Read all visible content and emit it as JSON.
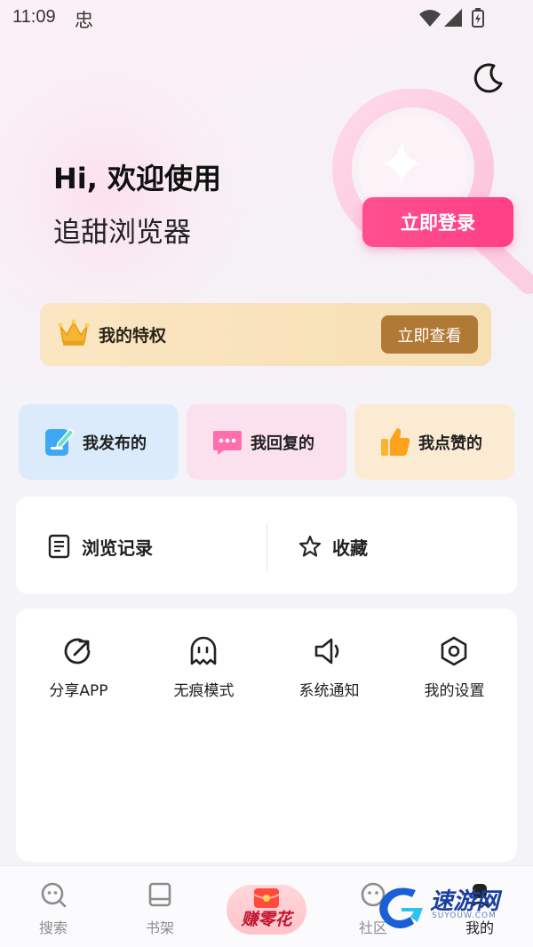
{
  "status_bar": {
    "time": "11:09",
    "extra_glyph": "忠"
  },
  "header": {
    "greeting": "Hi, 欢迎使用",
    "app_name": "追甜浏览器",
    "login_label": "立即登录"
  },
  "privilege": {
    "label": "我的特权",
    "button_label": "立即查看"
  },
  "quick_actions": [
    {
      "label": "我发布的",
      "icon": "edit-note-icon"
    },
    {
      "label": "我回复的",
      "icon": "chat-bubble-icon"
    },
    {
      "label": "我点赞的",
      "icon": "thumbs-up-icon"
    }
  ],
  "history": [
    {
      "label": "浏览记录",
      "icon": "document-list-icon"
    },
    {
      "label": "收藏",
      "icon": "star-outline-icon"
    }
  ],
  "tools": [
    {
      "label": "分享APP",
      "icon": "share-icon"
    },
    {
      "label": "无痕模式",
      "icon": "ghost-icon"
    },
    {
      "label": "系统通知",
      "icon": "speaker-icon"
    },
    {
      "label": "我的设置",
      "icon": "settings-hexagon-icon"
    }
  ],
  "tabbar": {
    "search": "搜索",
    "bookshelf": "书架",
    "earn": "赚零花",
    "community": "社区",
    "mine": "我的"
  },
  "watermark": {
    "text": "速游网",
    "sub": "SUYOUW.COM"
  },
  "colors": {
    "accent_pink": "#ff3f86",
    "privilege_button": "#b07a36",
    "watermark_blue": "#1a3f9e"
  }
}
